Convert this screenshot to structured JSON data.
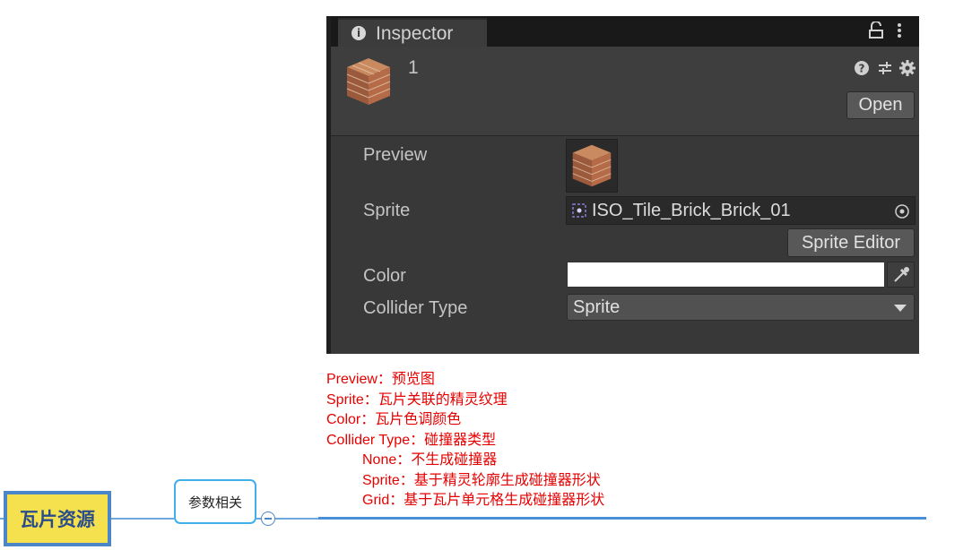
{
  "inspector": {
    "tab_label": "Inspector",
    "asset_name": "1",
    "open_label": "Open",
    "properties": {
      "preview_label": "Preview",
      "sprite_label": "Sprite",
      "sprite_value": "ISO_Tile_Brick_Brick_01",
      "sprite_editor_label": "Sprite Editor",
      "color_label": "Color",
      "color_value": "#ffffff",
      "collider_type_label": "Collider Type",
      "collider_type_value": "Sprite"
    }
  },
  "notes": [
    "Preview：预览图",
    "Sprite：瓦片关联的精灵纹理",
    "Color：瓦片色调颜色",
    "Collider Type：碰撞器类型",
    "None：不生成碰撞器",
    "Sprite：基于精灵轮廓生成碰撞器形状",
    "Grid：基于瓦片单元格生成碰撞器形状"
  ],
  "mindmap": {
    "root_label": "瓦片资源",
    "child_label": "参数相关"
  },
  "colors": {
    "inspector_bg": "#383838",
    "note_text": "#e60000",
    "root_fill": "#f5e14d",
    "root_border": "#4a86c8",
    "child_border": "#3fb0e6"
  },
  "icons": [
    "info-icon",
    "lock-icon",
    "kebab-menu-icon",
    "help-icon",
    "preset-icon",
    "settings-icon",
    "object-picker-icon",
    "eyedropper-icon",
    "chevron-down-icon",
    "collapse-icon"
  ]
}
